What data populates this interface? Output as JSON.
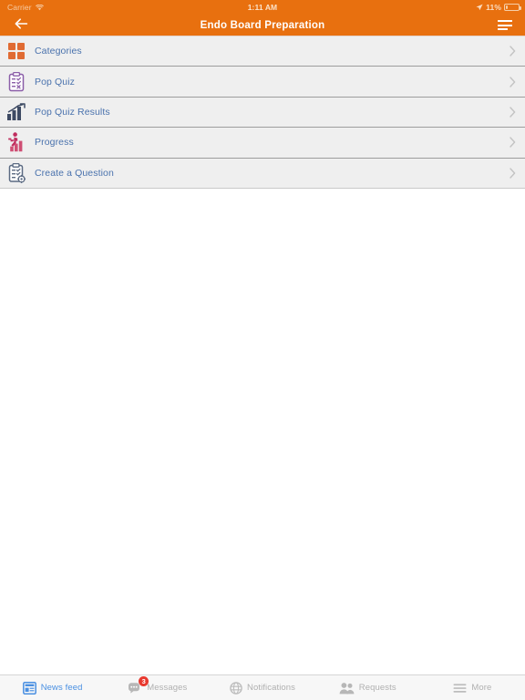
{
  "status_bar": {
    "carrier": "Carrier",
    "wifi_icon": "wifi-icon",
    "time": "1:11 AM",
    "location_icon": "location-arrow-icon",
    "battery_percent": "11%",
    "battery_icon": "battery-icon"
  },
  "nav": {
    "back_icon": "back-arrow-icon",
    "title": "Endo Board Preparation",
    "menu_icon": "hamburger-menu-icon"
  },
  "list": {
    "rows": [
      {
        "label": "Categories",
        "icon": "grid-squares-icon",
        "chevron": "chevron-right-icon"
      },
      {
        "label": "Pop Quiz",
        "icon": "clipboard-quiz-icon",
        "chevron": "chevron-right-icon"
      },
      {
        "label": "Pop Quiz Results",
        "icon": "bar-chart-arrow-icon",
        "chevron": "chevron-right-icon"
      },
      {
        "label": "Progress",
        "icon": "running-person-bars-icon",
        "chevron": "chevron-right-icon"
      },
      {
        "label": "Create a Question",
        "icon": "clipboard-gear-icon",
        "chevron": "chevron-right-icon"
      }
    ]
  },
  "tab_bar": {
    "tabs": [
      {
        "label": "News feed",
        "icon": "news-feed-icon",
        "active": true,
        "badge": ""
      },
      {
        "label": "Messages",
        "icon": "messages-icon",
        "active": false,
        "badge": "3"
      },
      {
        "label": "Notifications",
        "icon": "globe-icon",
        "active": false,
        "badge": ""
      },
      {
        "label": "Requests",
        "icon": "people-icon",
        "active": false,
        "badge": ""
      },
      {
        "label": "More",
        "icon": "hamburger-more-icon",
        "active": false,
        "badge": ""
      }
    ]
  },
  "colors": {
    "accent_orange": "#e8700f",
    "row_background": "#efefef",
    "link_blue": "#4a72ad",
    "tab_active_blue": "#4a90e2",
    "badge_red": "#e8392f"
  }
}
